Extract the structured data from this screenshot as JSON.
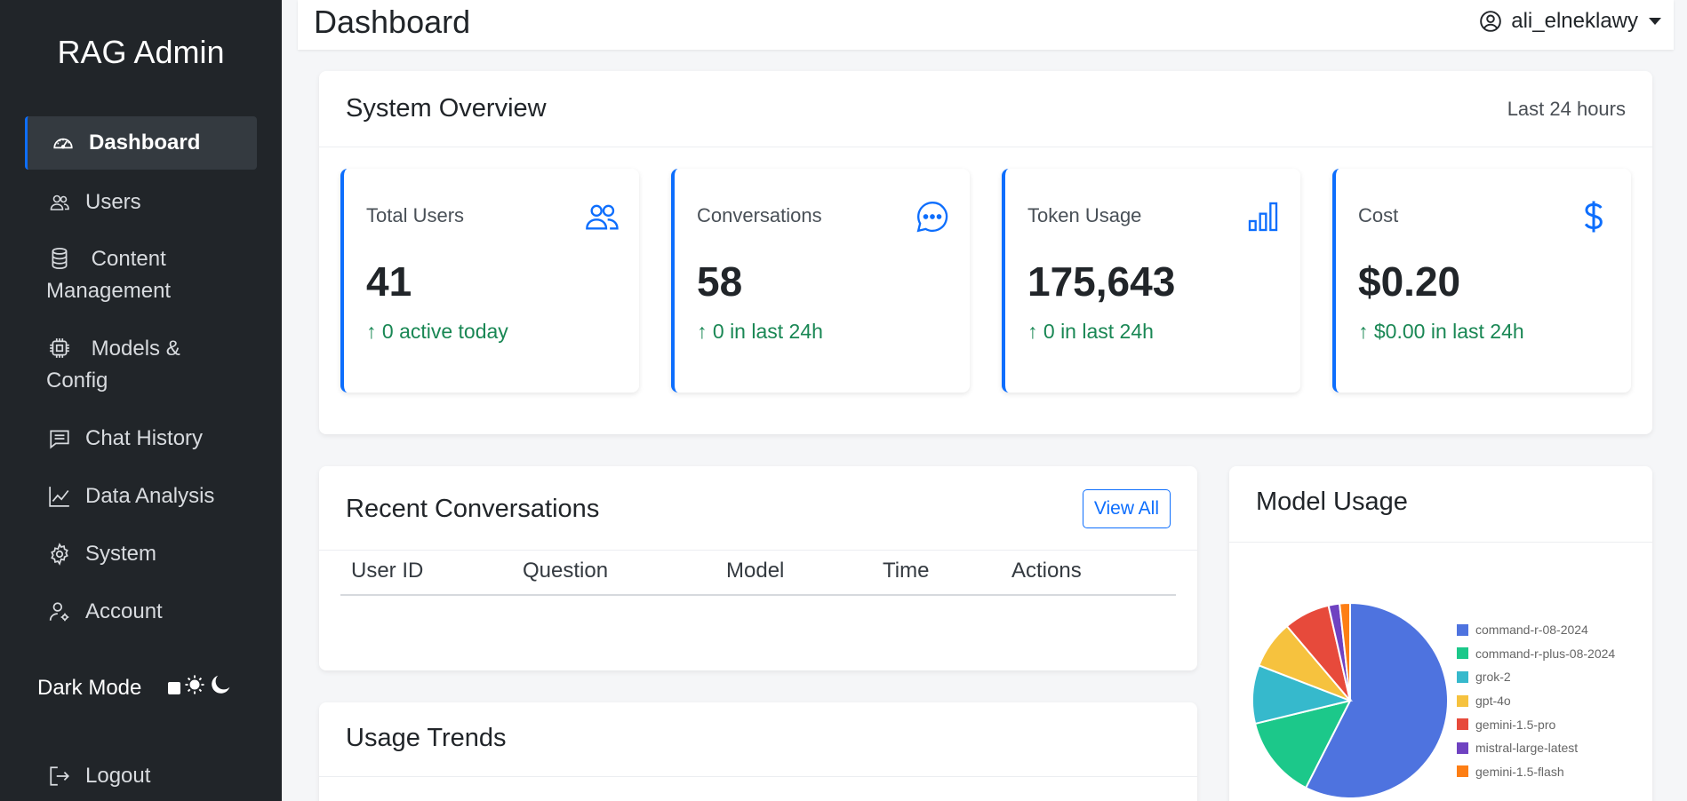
{
  "sidebar": {
    "brand": "RAG Admin",
    "items": [
      {
        "label": "Dashboard",
        "icon": "speedometer-icon"
      },
      {
        "label": "Users",
        "icon": "users-icon"
      },
      {
        "label": "Content Management",
        "icon": "database-icon"
      },
      {
        "label": "Models & Config",
        "icon": "cpu-icon"
      },
      {
        "label": "Chat History",
        "icon": "chat-icon"
      },
      {
        "label": "Data Analysis",
        "icon": "line-chart-icon"
      },
      {
        "label": "System",
        "icon": "gear-icon"
      },
      {
        "label": "Account",
        "icon": "user-gear-icon"
      }
    ],
    "dark_mode_label": "Dark Mode",
    "logout_label": "Logout"
  },
  "header": {
    "title": "Dashboard",
    "username": "ali_elneklawy"
  },
  "overview": {
    "title": "System Overview",
    "range": "Last 24 hours",
    "stats": [
      {
        "label": "Total Users",
        "value": "41",
        "delta": "0 active today",
        "icon": "people-icon"
      },
      {
        "label": "Conversations",
        "value": "58",
        "delta": "0 in last 24h",
        "icon": "chat-dots-icon"
      },
      {
        "label": "Token Usage",
        "value": "175,643",
        "delta": "0 in last 24h",
        "icon": "bar-chart-icon"
      },
      {
        "label": "Cost",
        "value": "$0.20",
        "delta": "$0.00 in last 24h",
        "icon": "dollar-icon"
      }
    ],
    "accent": "#0d6efd",
    "delta_color": "#198754"
  },
  "recent": {
    "title": "Recent Conversations",
    "view_all": "View All",
    "columns": [
      "User ID",
      "Question",
      "Model",
      "Time",
      "Actions"
    ]
  },
  "trends": {
    "title": "Usage Trends"
  },
  "model_usage": {
    "title": "Model Usage"
  },
  "chart_data": {
    "type": "pie",
    "categories": [
      "command-r-08-2024",
      "command-r-plus-08-2024",
      "grok-2",
      "gpt-4o",
      "gemini-1.5-pro",
      "mistral-large-latest",
      "gemini-1.5-flash"
    ],
    "values": [
      56.5,
      13.5,
      9.5,
      7.8,
      7.5,
      1.8,
      1.7
    ],
    "colors": [
      "#4e73df",
      "#1cc88a",
      "#36b9cc",
      "#f6c23e",
      "#e74a3b",
      "#6f42c1",
      "#fd7e14"
    ],
    "legend": "right"
  }
}
